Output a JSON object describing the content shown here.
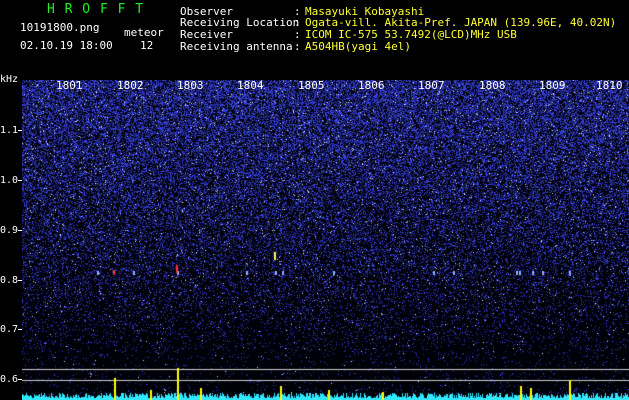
{
  "header": {
    "logo": "H R O F F T",
    "filename": "10191800.png",
    "datetime": "02.10.19 18:00",
    "meteor_label": "meteor",
    "meteor_count": "12",
    "fields": [
      {
        "label": "Observer",
        "value": "Masayuki Kobayashi"
      },
      {
        "label": "Receiving Location",
        "value": "Ogata-vill. Akita-Pref. JAPAN (139.96E, 40.02N)"
      },
      {
        "label": "Receiver",
        "value": "ICOM IC-575 53.7492(@LCD)MHz USB"
      },
      {
        "label": "Receiving antenna",
        "value": "A504HB(yagi 4el)"
      }
    ],
    "separator": ":"
  },
  "axis": {
    "unit": "kHz",
    "ticks": [
      "1.1",
      "1.0",
      "0.9",
      "0.8",
      "0.7",
      "0.6"
    ]
  },
  "minute_marks": [
    "1801",
    "1802",
    "1803",
    "1804",
    "1805",
    "1806",
    "1807",
    "1808",
    "1809",
    "1810"
  ],
  "colors": {
    "background": "#000000",
    "text": "#ffffff",
    "header_value": "#ffff33",
    "logo": "#22ee22",
    "noise_blue": "#3a49ff",
    "echo_red": "#ff3030",
    "histogram": "#30e8ff",
    "meteor_spike": "#ffff00"
  }
}
